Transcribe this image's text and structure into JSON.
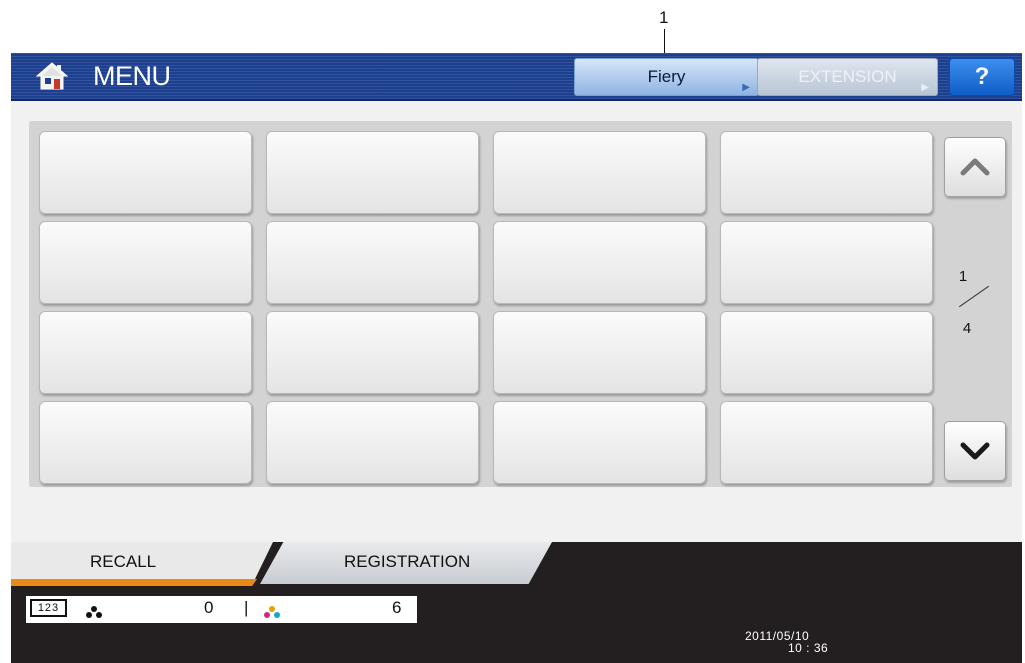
{
  "callout": {
    "number": "1"
  },
  "header": {
    "title": "MENU",
    "home_icon": "home-icon",
    "tabs": {
      "fiery": "Fiery",
      "extension": "EXTENSION"
    },
    "help": "?"
  },
  "grid": {
    "rows": 4,
    "columns": 4
  },
  "pagination": {
    "current": "1",
    "total": "4"
  },
  "bottom_tabs": {
    "recall": "RECALL",
    "registration": "REGISTRATION"
  },
  "counters": {
    "mode": "123",
    "black": "0",
    "separator": "|",
    "color": "6"
  },
  "datetime": {
    "date": "2011/05/10",
    "time": "10 : 36"
  },
  "colors": {
    "title_bar": "#1c3f8f",
    "fiery_tab": "#8fb4e2",
    "help_button": "#1f74de",
    "recall_accent": "#e98a17",
    "status_bar": "#231f20"
  }
}
